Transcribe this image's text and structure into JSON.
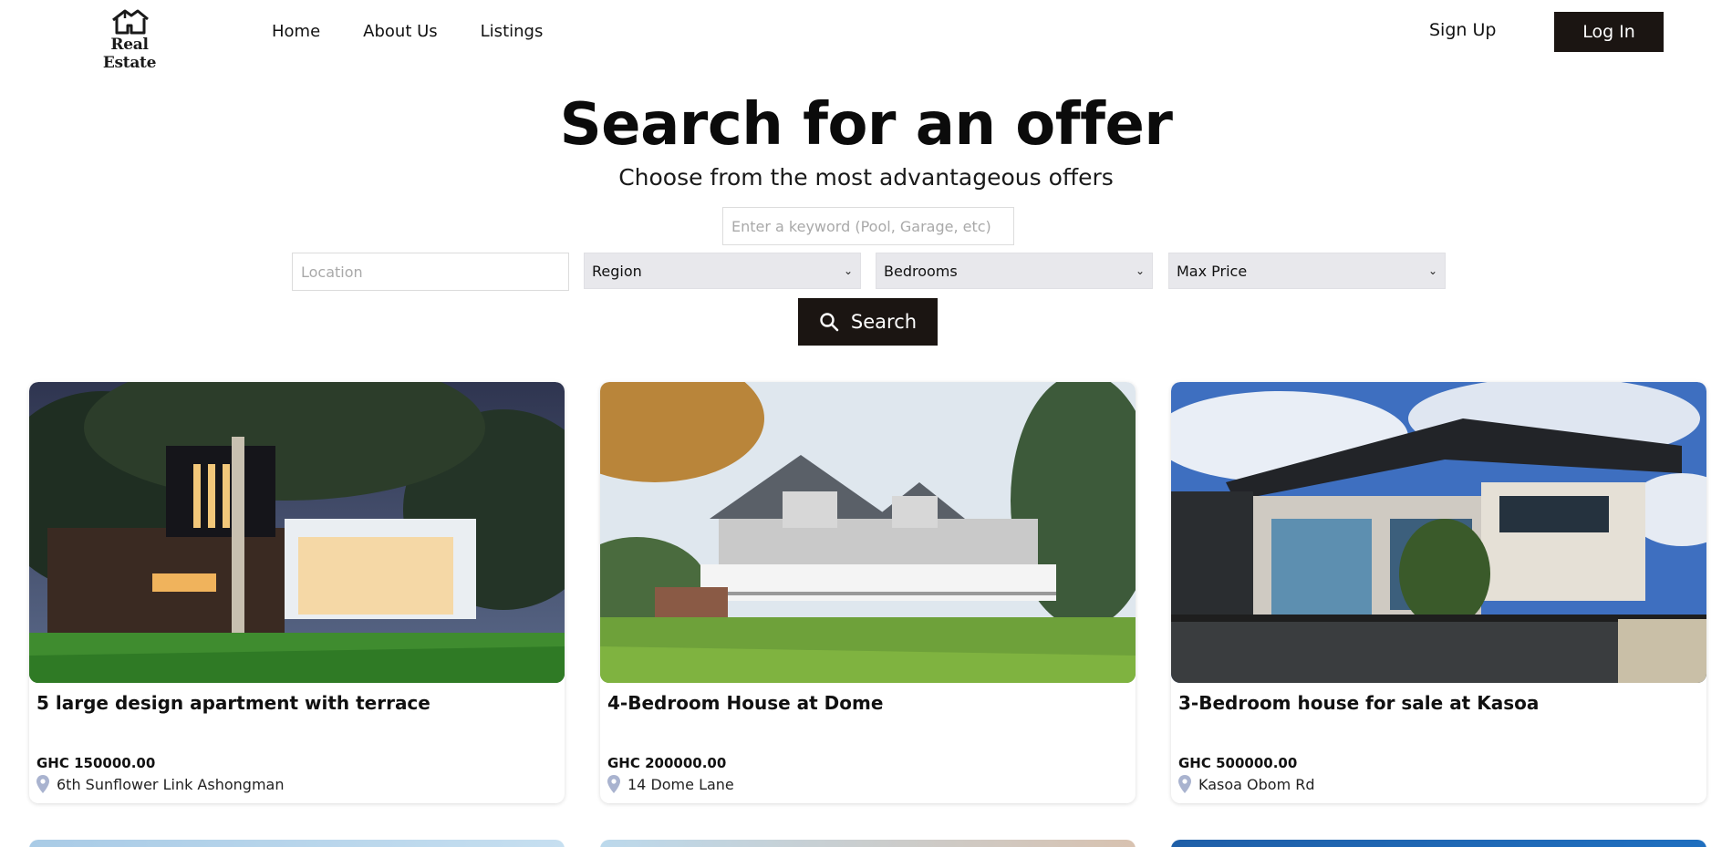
{
  "header": {
    "logo_text": "Real Estate",
    "nav": [
      "Home",
      "About Us",
      "Listings"
    ],
    "signup_label": "Sign Up",
    "login_label": "Log In"
  },
  "hero": {
    "title": "Search for an offer",
    "subtitle": "Choose from the most advantageous offers"
  },
  "search": {
    "keyword_placeholder": "Enter a keyword (Pool, Garage, etc)",
    "keyword_value": "",
    "location_placeholder": "Location",
    "location_value": "",
    "region": "Region",
    "bedrooms": "Bedrooms",
    "max_price": "Max Price",
    "button_label": "Search",
    "button_icon": "search-icon"
  },
  "listings": [
    {
      "title": "5 large design apartment with terrace",
      "price": "GHC 150000.00",
      "location": "6th Sunflower Link Ashongman"
    },
    {
      "title": "4-Bedroom House at Dome",
      "price": "GHC 200000.00",
      "location": "14 Dome Lane"
    },
    {
      "title": "3-Bedroom house for sale at Kasoa",
      "price": "GHC 500000.00",
      "location": "Kasoa Obom Rd"
    }
  ],
  "colors": {
    "primary_button": "#1b1512",
    "select_bg": "#e8e8ec",
    "location_pin": "#a9b3cf"
  }
}
